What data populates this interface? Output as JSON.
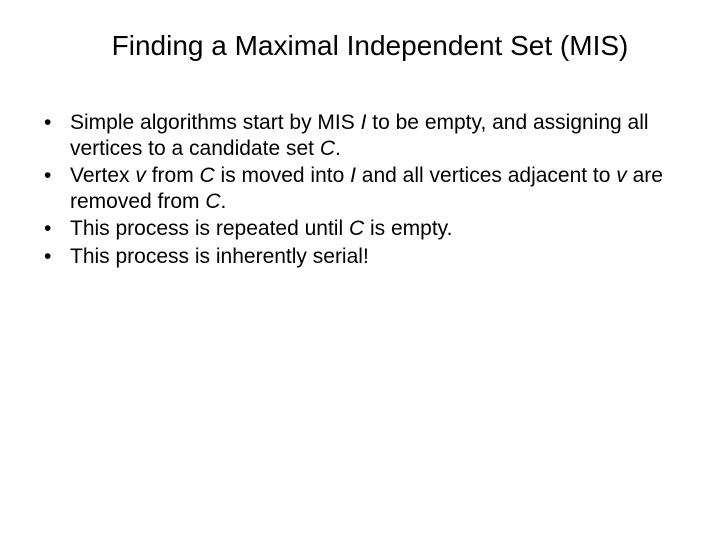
{
  "slide": {
    "title": "Finding a Maximal Independent Set (MIS)",
    "bullets": {
      "b1a": "Simple algorithms start by MIS ",
      "b1b": "I",
      "b1c": " to be empty, and assigning all vertices to a candidate set ",
      "b1d": "C",
      "b1e": ".",
      "b2a": "Vertex ",
      "b2b": "v",
      "b2c": " from ",
      "b2d": "C",
      "b2e": " is moved into ",
      "b2f": "I",
      "b2g": " and all vertices adjacent to ",
      "b2h": "v",
      "b2i": " are removed from ",
      "b2j": "C",
      "b2k": ".",
      "b3a": "This process is repeated until ",
      "b3b": "C",
      "b3c": " is empty.",
      "b4": "This process is inherently serial!"
    }
  }
}
